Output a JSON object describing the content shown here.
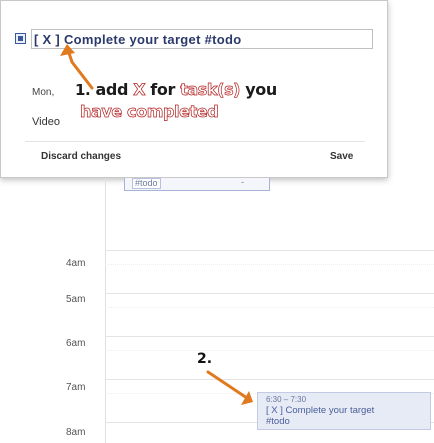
{
  "editor": {
    "title_value": "[ X ] Complete your target #todo",
    "date_partial": "Mon,",
    "video_label": "Video",
    "discard_label": "Discard changes",
    "save_label": "Save"
  },
  "annotation": {
    "step1_number": "1.",
    "step1_part1": "add ",
    "step1_x": "X",
    "step1_part2": " for ",
    "step1_task": "task(s)",
    "step1_part3": " you",
    "step1_line2a": "have ",
    "step1_line2b": "completed",
    "step2_number": "2."
  },
  "calendar": {
    "allday_event_title": "#todo",
    "allday_event_dash": "-",
    "hours": [
      "4am",
      "5am",
      "6am",
      "7am",
      "8am"
    ],
    "event": {
      "time": "6:30 – 7:30",
      "title": "[ X ] Complete your target #todo"
    }
  },
  "colors": {
    "event_background": "#e7ebf6",
    "event_text": "#4a5f99",
    "annotation_outline": "#b21c1c",
    "arrow": "#e07a1f"
  }
}
